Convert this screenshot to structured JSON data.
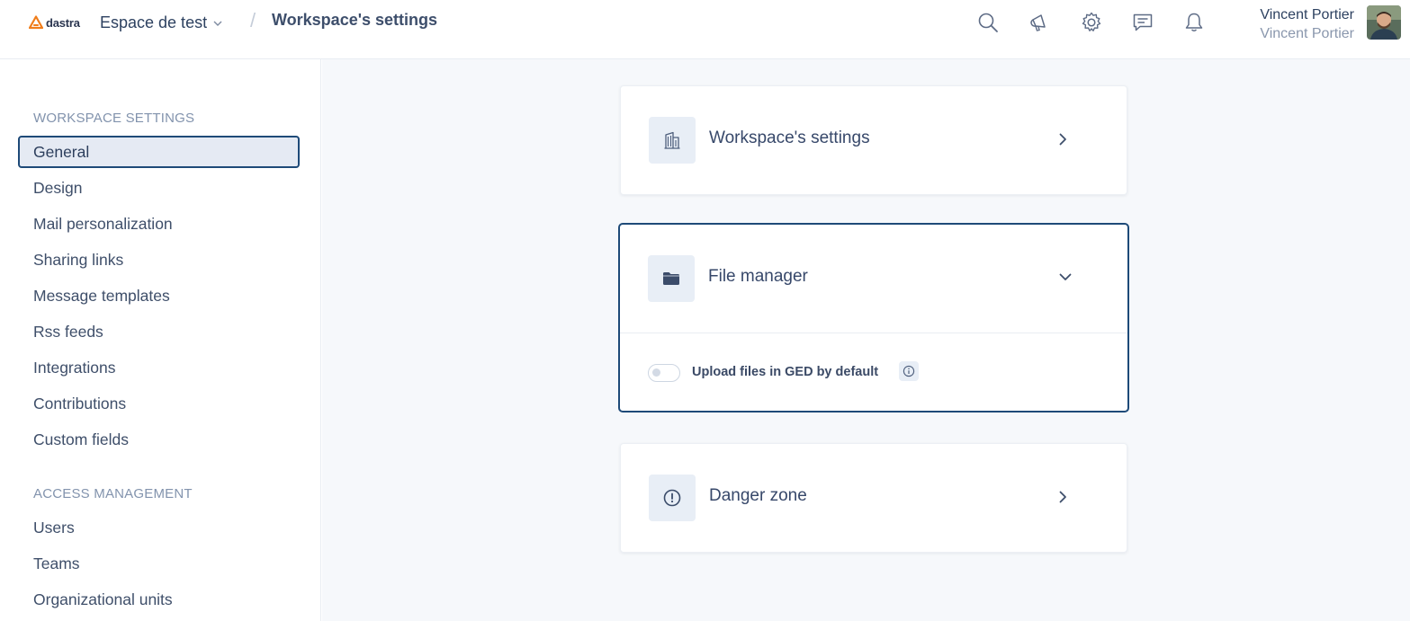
{
  "header": {
    "logo_text": "dastra",
    "workspace_name": "Espace de test",
    "breadcrumb_separator": "/",
    "page_title": "Workspace's settings",
    "user_name": "Vincent Portier",
    "user_subtitle": "Vincent Portier"
  },
  "icons": {
    "top": [
      "search-icon",
      "megaphone-icon",
      "gear-icon",
      "chat-icon",
      "bell-icon"
    ]
  },
  "sidebar": {
    "sections": [
      {
        "label": "WORKSPACE SETTINGS",
        "items": [
          {
            "label": "General",
            "active": true
          },
          {
            "label": "Design"
          },
          {
            "label": "Mail personalization"
          },
          {
            "label": "Sharing links"
          },
          {
            "label": "Message templates"
          },
          {
            "label": "Rss feeds"
          },
          {
            "label": "Integrations"
          },
          {
            "label": "Contributions"
          },
          {
            "label": "Custom fields"
          }
        ]
      },
      {
        "label": "ACCESS MANAGEMENT",
        "items": [
          {
            "label": "Users"
          },
          {
            "label": "Teams"
          },
          {
            "label": "Organizational units"
          }
        ]
      }
    ]
  },
  "cards": [
    {
      "title": "Workspace's settings",
      "icon": "building-icon",
      "expanded": false
    },
    {
      "title": "File manager",
      "icon": "folder-icon",
      "expanded": true,
      "toggle": {
        "label": "Upload files in GED by default",
        "checked": false
      }
    },
    {
      "title": "Danger zone",
      "icon": "alert-circle-icon",
      "expanded": false
    }
  ],
  "colors": {
    "accent": "#1e4a78",
    "logo_orange": "#f07d1a",
    "background": "#f6f8fb"
  }
}
